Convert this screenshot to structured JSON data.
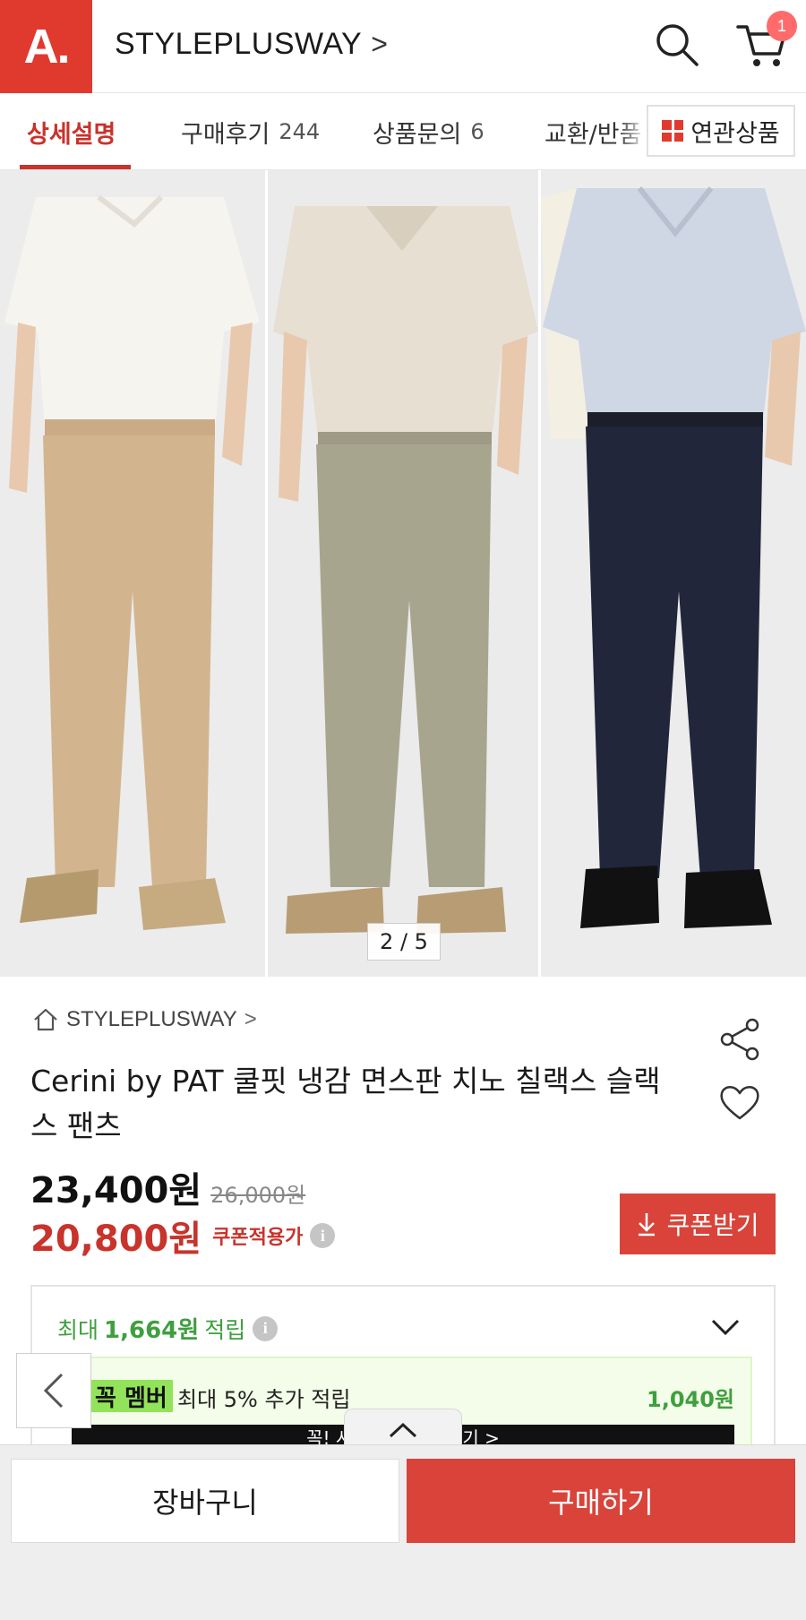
{
  "header": {
    "logo_text": "A.",
    "brand_link": "STYLEPLUSWAY",
    "cart_count": "1",
    "accent_color": "#e03a2f"
  },
  "tabs": [
    {
      "label": "상세설명",
      "count": ""
    },
    {
      "label": "구매후기",
      "count": "244"
    },
    {
      "label": "상품문의",
      "count": "6"
    },
    {
      "label": "교환/반품",
      "count": ""
    }
  ],
  "related_button": "연관상품",
  "gallery": {
    "counter": "2 / 5"
  },
  "product": {
    "shop_name": "STYLEPLUSWAY",
    "title": "Cerini by PAT 쿨핏 냉감 면스판 치노 칠랙스 슬랙스 팬츠",
    "price": "23,400원",
    "original_price": "26,000원",
    "coupon_price": "20,800원",
    "coupon_label": "쿠폰적용가",
    "coupon_button": "쿠폰받기"
  },
  "points": {
    "prefix": "최대",
    "amount": "1,664원",
    "suffix": "적립",
    "member_tag": "꼭 멤버",
    "member_text": "최대 5% 추가 적립",
    "member_amount": "1,040원",
    "banner_text": "꼭! 시작하고 혜택 받기 >"
  },
  "bottom_bar": {
    "cart_label": "장바구니",
    "buy_label": "구매하기"
  }
}
